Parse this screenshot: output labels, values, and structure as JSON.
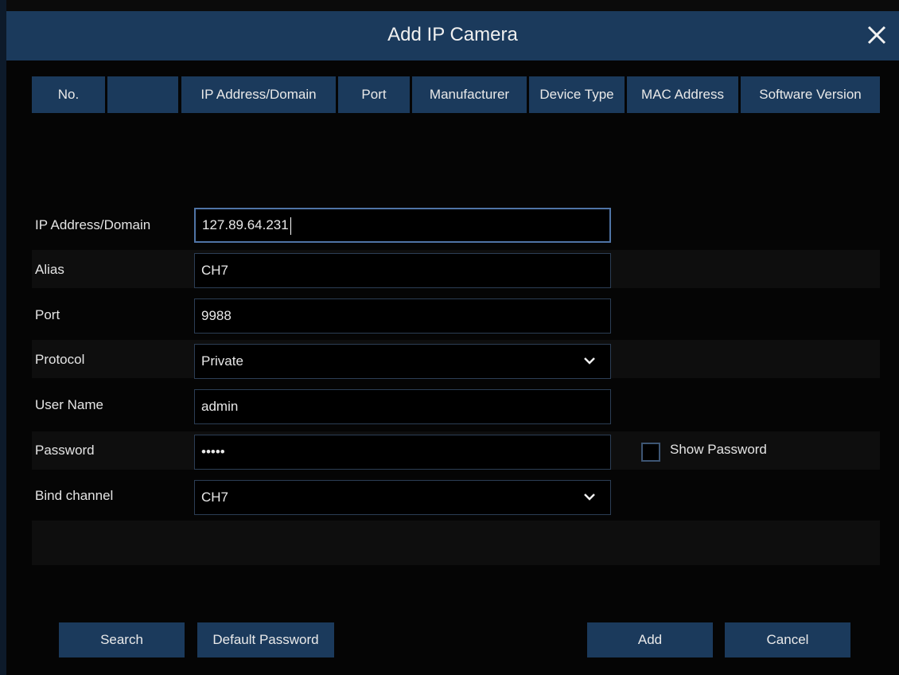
{
  "dialog": {
    "title": "Add IP Camera"
  },
  "table": {
    "columns": [
      "No.",
      "",
      "IP Address/Domain",
      "Port",
      "Manufacturer",
      "Device Type",
      "MAC Address",
      "Software Version"
    ]
  },
  "form": {
    "ip_label": "IP Address/Domain",
    "ip_value": "127.89.64.231",
    "alias_label": "Alias",
    "alias_value": "CH7",
    "port_label": "Port",
    "port_value": "9988",
    "protocol_label": "Protocol",
    "protocol_value": "Private",
    "username_label": "User Name",
    "username_value": "admin",
    "password_label": "Password",
    "password_value": "•••••",
    "show_password_label": "Show Password",
    "bind_channel_label": "Bind channel",
    "bind_channel_value": "CH7"
  },
  "buttons": {
    "search": "Search",
    "default_password": "Default Password",
    "add": "Add",
    "cancel": "Cancel"
  },
  "icons": {
    "close": "close-icon",
    "dropdown": "chevron-down-icon",
    "checkbox": "checkbox-icon"
  },
  "colors": {
    "header_bg": "#1b3a5c",
    "background": "#050505",
    "field_border": "#2c3e55",
    "field_active_border": "#4f74a6"
  }
}
